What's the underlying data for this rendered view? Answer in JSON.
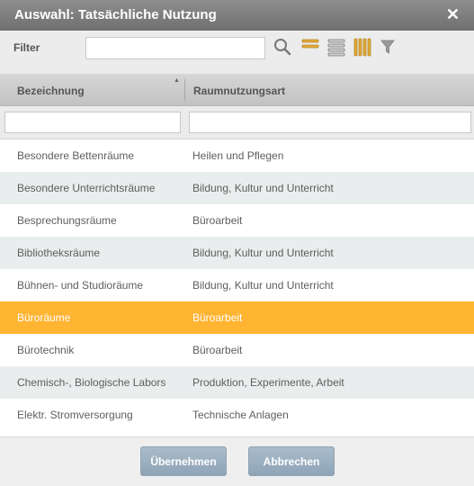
{
  "dialog": {
    "title": "Auswahl: Tatsächliche Nutzung",
    "close_icon": "close-icon"
  },
  "filter": {
    "label": "Filter",
    "value": "",
    "placeholder": "",
    "icons": [
      "search-icon",
      "collapse-rows-icon",
      "expand-rows-icon",
      "columns-icon",
      "funnel-icon"
    ]
  },
  "table": {
    "columns": [
      "Bezeichnung",
      "Raumnutzungsart"
    ],
    "sort": {
      "column": "Bezeichnung",
      "direction": "ascending"
    },
    "column_filters": [
      "",
      ""
    ],
    "rows": [
      {
        "bezeichnung": "Besondere Betten­räume",
        "raumnutzungsart": "Heilen und Pflegen",
        "selected": false
      },
      {
        "bezeichnung": "Besondere Unterrichtsräume",
        "raumnutzungsart": "Bildung, Kultur und Unterricht",
        "selected": false
      },
      {
        "bezeichnung": "Besprechungsräume",
        "raumnutzungsart": "Büroarbeit",
        "selected": false
      },
      {
        "bezeichnung": "Bibliotheksräume",
        "raumnutzungsart": "Bildung, Kultur und Unterricht",
        "selected": false
      },
      {
        "bezeichnung": "Bühnen- und Studioräume",
        "raumnutzungsart": "Bildung, Kultur und Unterricht",
        "selected": false
      },
      {
        "bezeichnung": "Büroräume",
        "raumnutzungsart": "Büroarbeit",
        "selected": true
      },
      {
        "bezeichnung": "Bürotechnik",
        "raumnutzungsart": "Büroarbeit",
        "selected": false
      },
      {
        "bezeichnung": "Chemisch-, Biologische Labors",
        "raumnutzungsart": "Produktion, Experimente, Arbeit",
        "selected": false
      },
      {
        "bezeichnung": "Elektr. Stromversorgung",
        "raumnutzungsart": "Technische Anlagen",
        "selected": false
      }
    ]
  },
  "footer": {
    "ok_label": "Übernehmen",
    "cancel_label": "Abbrechen"
  },
  "colors": {
    "titlebar": "#7d7d7d",
    "selected_row": "#ffb432",
    "button": "#9fb3c3",
    "icon_accent": "#e0a838"
  }
}
